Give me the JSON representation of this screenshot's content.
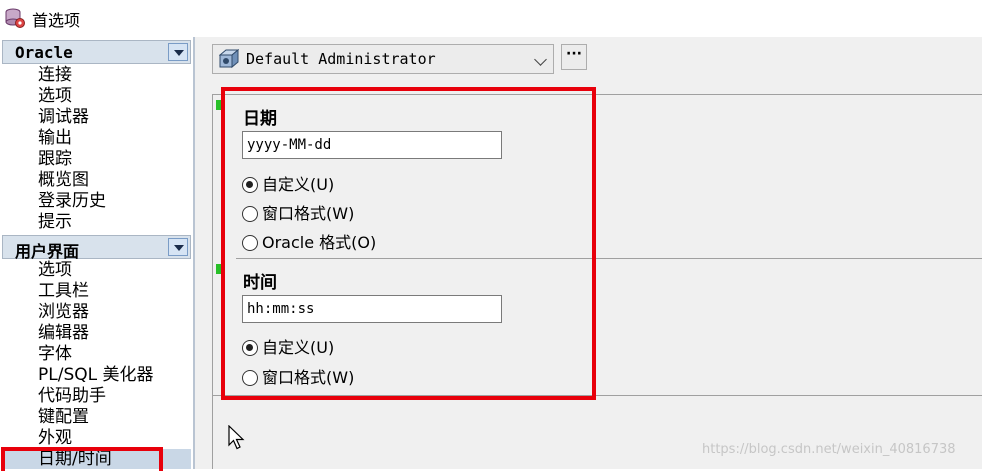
{
  "window": {
    "title": "首选项",
    "icon": "database-settings-icon"
  },
  "sidebar": {
    "groups": [
      {
        "label": "Oracle",
        "items": [
          "连接",
          "选项",
          "调试器",
          "输出",
          "跟踪",
          "概览图",
          "登录历史",
          "提示"
        ]
      },
      {
        "label": "用户界面",
        "items": [
          "选项",
          "工具栏",
          "浏览器",
          "编辑器",
          "字体",
          "PL/SQL 美化器",
          "代码助手",
          "键配置",
          "外观",
          "日期/时间"
        ]
      }
    ],
    "selected": "日期/时间"
  },
  "profile": {
    "value": "Default Administrator",
    "more_label": "···"
  },
  "date_section": {
    "title": "日期",
    "format_value": "yyyy-MM-dd",
    "options": [
      "自定义(U)",
      "窗口格式(W)",
      "Oracle 格式(O)"
    ],
    "selected_index": 0
  },
  "time_section": {
    "title": "时间",
    "format_value": "hh:mm:ss",
    "options": [
      "自定义(U)",
      "窗口格式(W)"
    ],
    "selected_index": 0
  },
  "watermark": "https://blog.csdn.net/weixin_40816738",
  "colors": {
    "highlight": "#e8000b",
    "selection": "#c9d7e6",
    "group_header": "#d8e2ec"
  }
}
